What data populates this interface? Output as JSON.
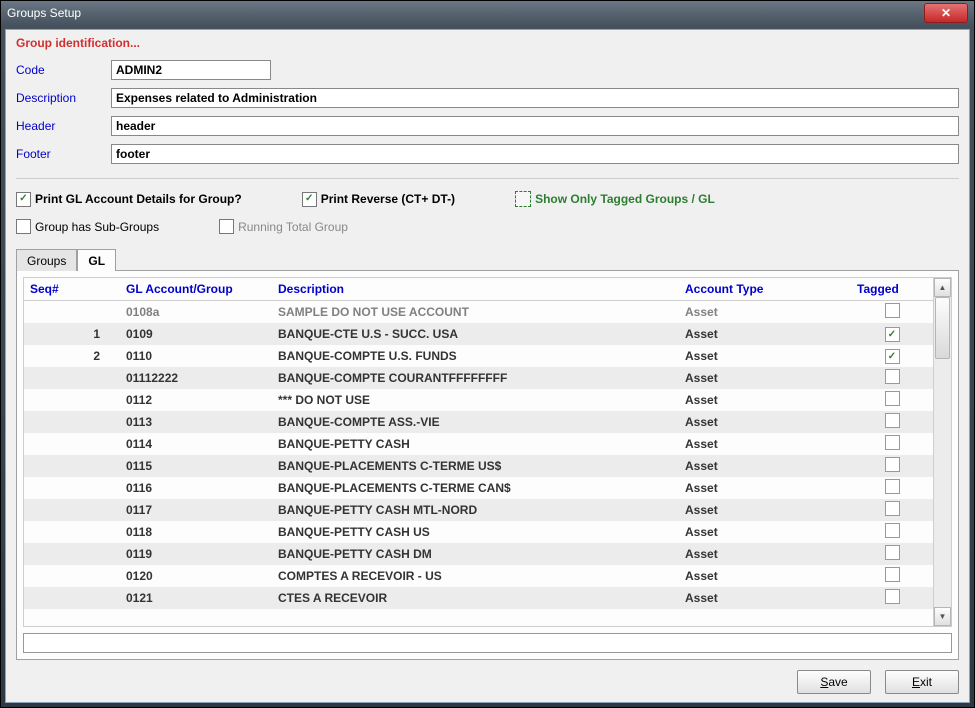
{
  "window": {
    "title": "Groups Setup"
  },
  "group_ident_label": "Group identification...",
  "fields": {
    "code_label": "Code",
    "code_value": "ADMIN2",
    "desc_label": "Description",
    "desc_value": "Expenses related to Administration",
    "header_label": "Header",
    "header_value": "header",
    "footer_label": "Footer",
    "footer_value": "footer"
  },
  "checks": {
    "print_details_label": "Print GL Account Details for Group?",
    "print_reverse_label": "Print Reverse (CT+ DT-)",
    "show_tagged_label": "Show Only Tagged Groups / GL",
    "has_subgroups_label": "Group has Sub-Groups",
    "running_total_label": "Running Total Group"
  },
  "tabs": {
    "groups": "Groups",
    "gl": "GL"
  },
  "table": {
    "headers": {
      "seq": "Seq#",
      "gl": "GL Account/Group",
      "desc": "Description",
      "type": "Account Type",
      "tagged": "Tagged"
    },
    "rows": [
      {
        "seq": "",
        "gl": "0108a",
        "desc": "SAMPLE DO NOT USE ACCOUNT",
        "type": "Asset",
        "tagged": false,
        "muted": true
      },
      {
        "seq": "1",
        "gl": "0109",
        "desc": "BANQUE-CTE U.S - SUCC. USA",
        "type": "Asset",
        "tagged": true
      },
      {
        "seq": "2",
        "gl": "0110",
        "desc": "BANQUE-COMPTE U.S. FUNDS",
        "type": "Asset",
        "tagged": true
      },
      {
        "seq": "",
        "gl": "01112222",
        "desc": "BANQUE-COMPTE COURANTFFFFFFFF",
        "type": "Asset",
        "tagged": false
      },
      {
        "seq": "",
        "gl": "0112",
        "desc": "*** DO NOT USE",
        "type": "Asset",
        "tagged": false
      },
      {
        "seq": "",
        "gl": "0113",
        "desc": "BANQUE-COMPTE ASS.-VIE",
        "type": "Asset",
        "tagged": false
      },
      {
        "seq": "",
        "gl": "0114",
        "desc": "BANQUE-PETTY CASH",
        "type": "Asset",
        "tagged": false
      },
      {
        "seq": "",
        "gl": "0115",
        "desc": "BANQUE-PLACEMENTS C-TERME US$",
        "type": "Asset",
        "tagged": false
      },
      {
        "seq": "",
        "gl": "0116",
        "desc": "BANQUE-PLACEMENTS C-TERME CAN$",
        "type": "Asset",
        "tagged": false
      },
      {
        "seq": "",
        "gl": "0117",
        "desc": "BANQUE-PETTY CASH MTL-NORD",
        "type": "Asset",
        "tagged": false
      },
      {
        "seq": "",
        "gl": "0118",
        "desc": "BANQUE-PETTY CASH US",
        "type": "Asset",
        "tagged": false
      },
      {
        "seq": "",
        "gl": "0119",
        "desc": "BANQUE-PETTY CASH DM",
        "type": "Asset",
        "tagged": false
      },
      {
        "seq": "",
        "gl": "0120",
        "desc": "COMPTES A RECEVOIR - US",
        "type": "Asset",
        "tagged": false
      },
      {
        "seq": "",
        "gl": "0121",
        "desc": "CTES A RECEVOIR",
        "type": "Asset",
        "tagged": false
      }
    ]
  },
  "buttons": {
    "save": "Save",
    "exit": "Exit"
  }
}
